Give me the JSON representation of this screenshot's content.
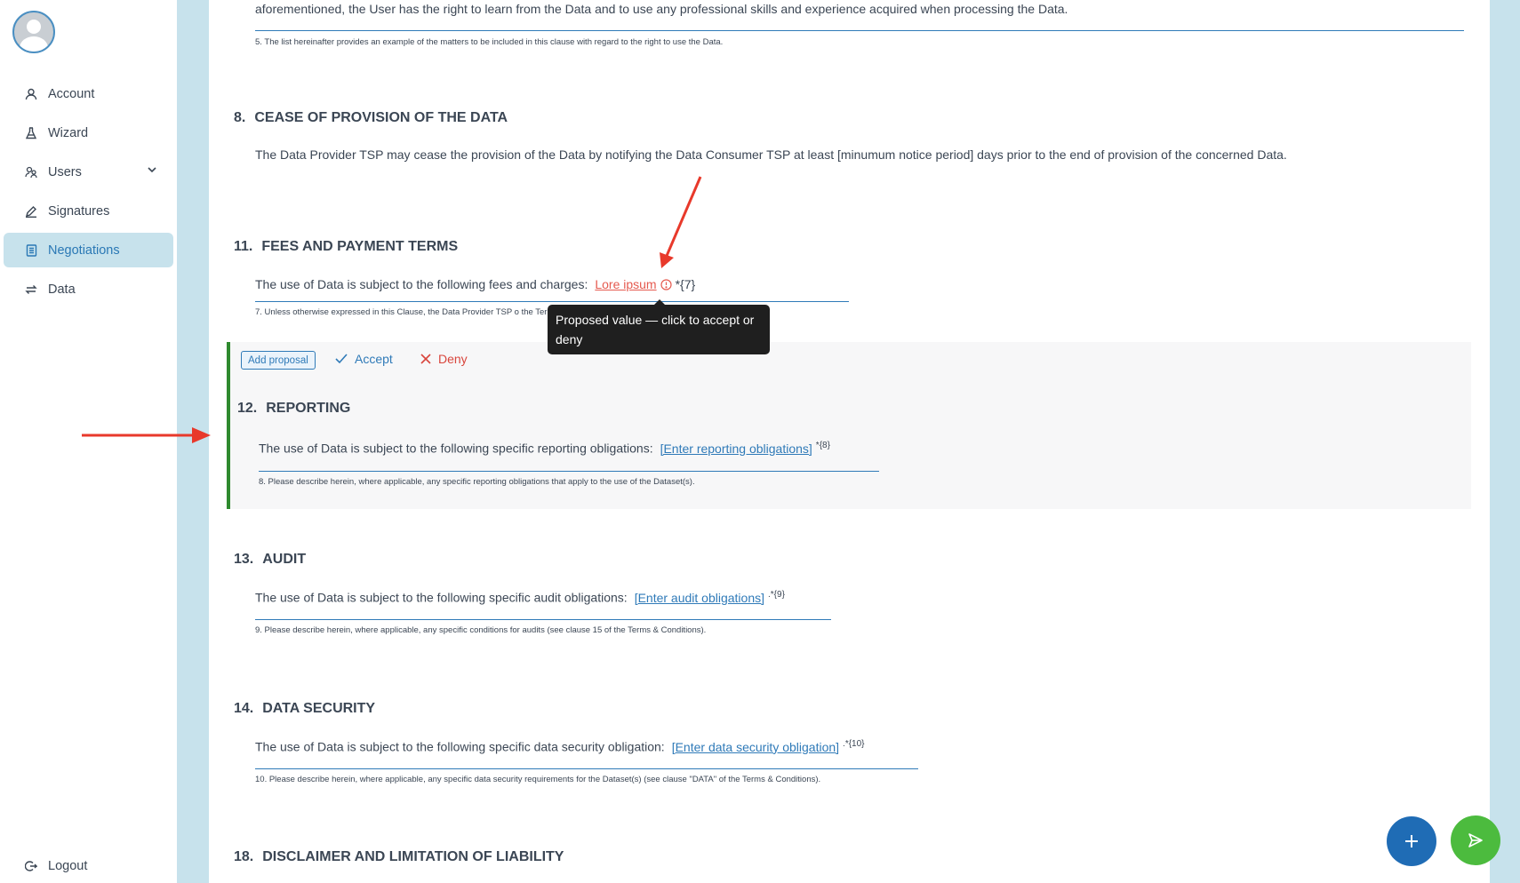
{
  "sidebar": {
    "nav": [
      {
        "label": "Account",
        "icon": "user-icon"
      },
      {
        "label": "Wizard",
        "icon": "flask-icon"
      },
      {
        "label": "Users",
        "icon": "users-icon"
      },
      {
        "label": "Signatures",
        "icon": "pen-icon"
      },
      {
        "label": "Negotiations",
        "icon": "document-icon"
      },
      {
        "label": "Data",
        "icon": "transfer-icon"
      }
    ],
    "active": "Negotiations",
    "logout": "Logout"
  },
  "document": {
    "top_text": "aforementioned, the User has the right to learn from the Data and to use any professional skills and experience acquired when processing the Data.",
    "top_footnote": "5. The list hereinafter provides an example of the matters to be included in this clause with regard to the right to use the Data.",
    "sections": [
      {
        "number": "8.",
        "title": "CEASE OF PROVISION OF THE DATA",
        "text": "The Data Provider TSP may cease the provision of the Data by notifying the Data Consumer TSP at least [minumum notice period] days prior to the end of provision of the concerned Data."
      },
      {
        "number": "11.",
        "title": "FEES AND PAYMENT TERMS",
        "text": "The use of Data is subject to the following fees and charges:",
        "proposed_value": "Lore ipsum",
        "ref": "*{7}",
        "footnote": "7. Unless otherwise expressed in this Clause, the Data Provider TSP o the Terms & Conditions)."
      },
      {
        "number": "12.",
        "title": "REPORTING",
        "text": "The use of Data is subject to the following specific reporting obligations:",
        "field": "[Enter reporting obligations]",
        "ref": "*{8}",
        "footnote": "8. Please describe herein, where applicable, any specific reporting obligations that apply to the use of the Dataset(s)."
      },
      {
        "number": "13.",
        "title": "AUDIT",
        "text": "The use of Data is subject to the following specific audit obligations:",
        "field": "[Enter audit obligations]",
        "ref": ".*{9}",
        "footnote": "9. Please describe herein, where applicable, any specific conditions for audits (see clause 15 of the Terms & Conditions)."
      },
      {
        "number": "14.",
        "title": "DATA SECURITY",
        "text": "The use of Data is subject to the following specific data security obligation:",
        "field": "[Enter data security obligation]",
        "ref": ".*{10}",
        "footnote": "10. Please describe herein, where applicable, any specific data security requirements for the Dataset(s) (see clause \"DATA\" of the Terms & Conditions)."
      },
      {
        "number": "18.",
        "title": "DISCLAIMER AND LIMITATION OF LIABILITY"
      }
    ],
    "proposal_actions": {
      "add_proposal": "Add proposal",
      "accept": "Accept",
      "deny": "Deny"
    },
    "tooltip": "Proposed value — click to accept or deny"
  },
  "fabs": {
    "add": "plus-icon",
    "send": "send-icon"
  },
  "colors": {
    "accent": "#2f7ab8",
    "proposed": "#e55a4f",
    "annotation_arrow": "#e8392b",
    "highlight_border": "#2e8a2e",
    "fab_add": "#1f6cb5",
    "fab_send": "#4cbb3e"
  }
}
